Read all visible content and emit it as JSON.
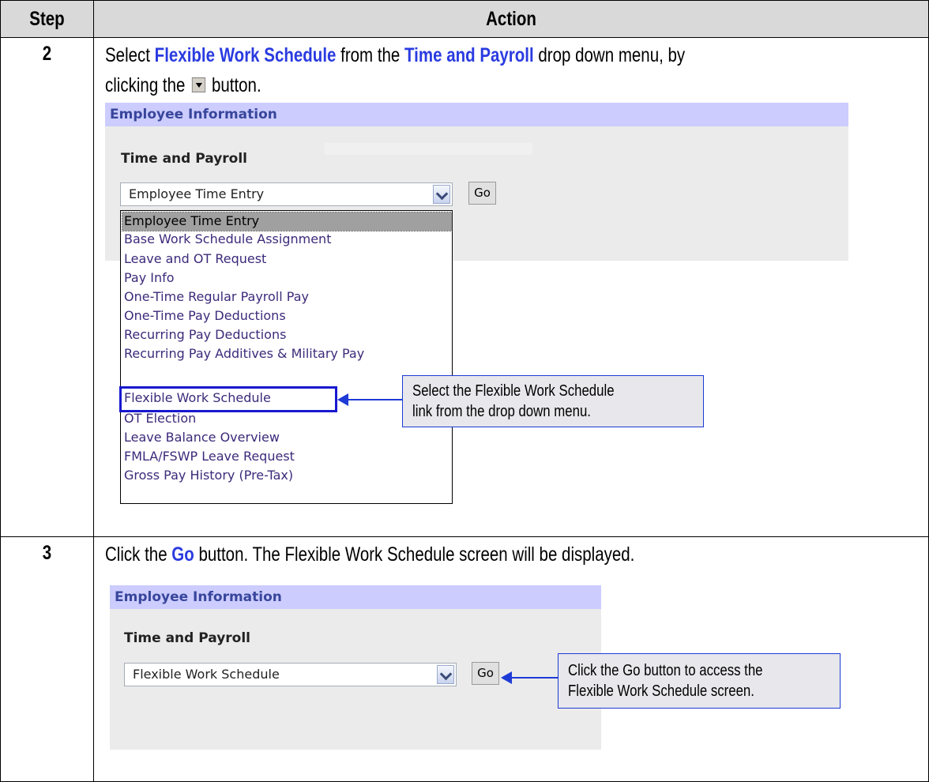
{
  "table": {
    "header_step": "Step",
    "header_action": "Action"
  },
  "step2": {
    "number": "2",
    "text_1": "Select ",
    "hl_1": "Flexible Work Schedule",
    "text_2": " from the ",
    "hl_2": "Time and Payroll",
    "text_3": " drop down menu, by",
    "text_4": "clicking the ",
    "text_5": " button.",
    "panel_title": "Employee Information",
    "label": "Time and Payroll",
    "select_value": "Employee Time Entry",
    "go_label": "Go",
    "dropdown_options": [
      "Employee Time Entry",
      "Base Work Schedule Assignment",
      "Leave and OT Request",
      "Pay Info",
      "One-Time Regular Payroll Pay",
      "One-Time Pay Deductions",
      "Recurring Pay Deductions",
      "Recurring Pay Additives & Military Pay",
      "Flexible Work Schedule",
      "OT Election",
      "Leave Balance Overview",
      "FMLA/FSWP Leave Request",
      "Gross Pay History (Pre-Tax)"
    ],
    "callout_line1": "Select the Flexible Work Schedule",
    "callout_line2": "link from the drop down menu."
  },
  "step3": {
    "number": "3",
    "text_1": "Click the ",
    "hl_1": "Go",
    "text_2": " button.  The Flexible Work Schedule screen will be displayed.",
    "panel_title": "Employee Information",
    "label": "Time and Payroll",
    "select_value": "Flexible Work Schedule",
    "go_label": "Go",
    "callout_line1": "Click the Go button to access the",
    "callout_line2": "Flexible Work Schedule screen."
  },
  "colors": {
    "highlight_text": "#2a3be0",
    "callout_border": "#1e3bd6",
    "panel_header": "#ccccff",
    "header_row": "#d9d9d9"
  }
}
